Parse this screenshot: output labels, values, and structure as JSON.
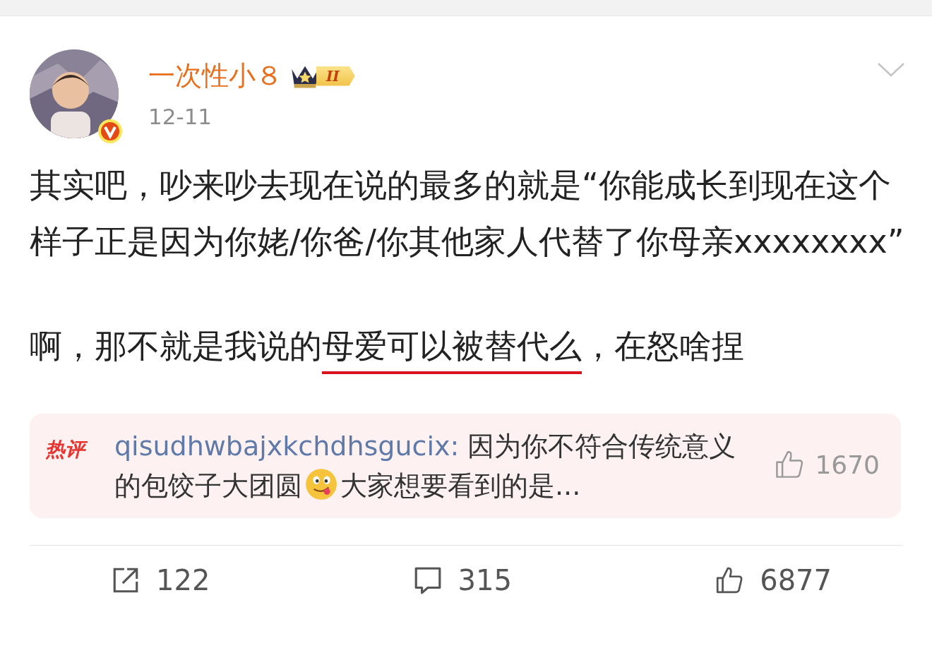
{
  "post": {
    "author": "一次性小８",
    "badge_level": "II",
    "verified": true,
    "date": "12-11",
    "paragraphs": [
      [
        {
          "text": "其实吧，吵来吵去现在说的最多的就是“你能成长到现在这个样子正是因为你姥/你爸/你其他家人代替了你母亲xxxxxxxx”",
          "underlined": false
        }
      ],
      [
        {
          "text": "啊，那不就是我说的",
          "underlined": false
        },
        {
          "text": "母爱可以被替代么",
          "underlined": true
        },
        {
          "text": "，在怒啥捏",
          "underlined": false
        }
      ]
    ]
  },
  "hot_comment": {
    "tag": "热评",
    "user": "qisudhwbajxkchdhsgucix:",
    "text_before": " 因为你不符合传统意义的包饺子大团圆",
    "text_after": "大家想要看到的是...",
    "likes": "1670"
  },
  "actions": [
    {
      "kind": "share",
      "count": "122"
    },
    {
      "kind": "comment",
      "count": "315"
    },
    {
      "kind": "like",
      "count": "6877"
    }
  ]
}
